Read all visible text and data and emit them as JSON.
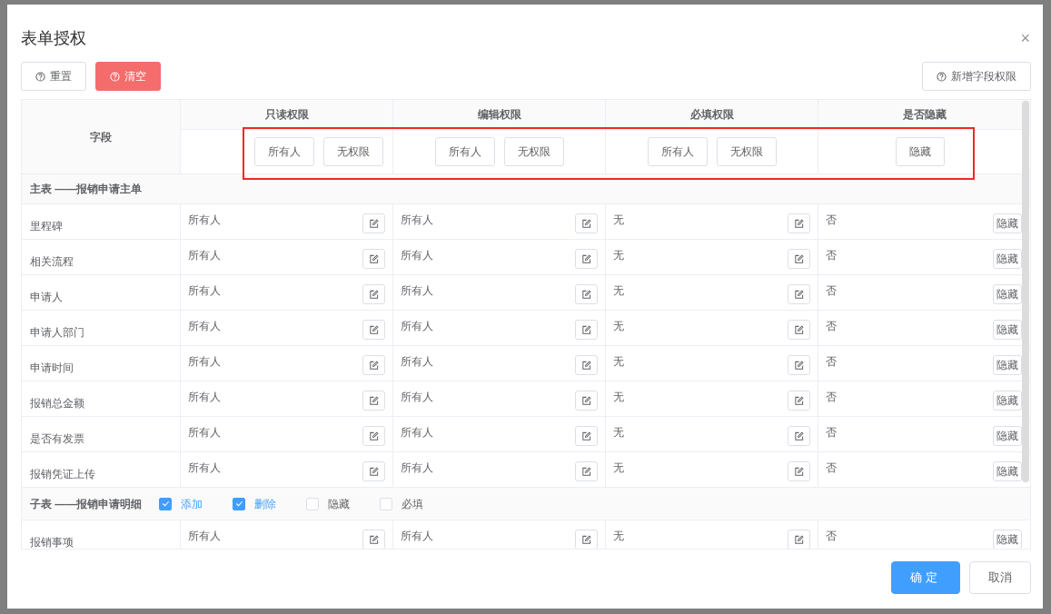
{
  "dialog": {
    "title": "表单授权",
    "close": "×"
  },
  "toolbar": {
    "left": [
      {
        "label": "重置",
        "kind": "default"
      },
      {
        "label": "清空",
        "kind": "danger"
      }
    ],
    "right": [
      {
        "label": "新增字段权限",
        "kind": "default"
      }
    ]
  },
  "table": {
    "columns": [
      "字段",
      "只读权限",
      "编辑权限",
      "必填权限",
      "是否隐藏"
    ],
    "header_actions": [
      [
        "所有人",
        "无权限"
      ],
      [
        "所有人",
        "无权限"
      ],
      [
        "所有人",
        "无权限"
      ],
      [
        "隐藏"
      ]
    ],
    "sections": [
      {
        "title": "主表 ——报销申请主单",
        "rows": [
          {
            "field": "里程碑",
            "readonly": "所有人",
            "edit": "所有人",
            "required": "无",
            "hidden": "否",
            "hide_button": "隐藏"
          },
          {
            "field": "相关流程",
            "readonly": "所有人",
            "edit": "所有人",
            "required": "无",
            "hidden": "否",
            "hide_button": "隐藏"
          },
          {
            "field": "申请人",
            "readonly": "所有人",
            "edit": "所有人",
            "required": "无",
            "hidden": "否",
            "hide_button": "隐藏"
          },
          {
            "field": "申请人部门",
            "readonly": "所有人",
            "edit": "所有人",
            "required": "无",
            "hidden": "否",
            "hide_button": "隐藏"
          },
          {
            "field": "申请时间",
            "readonly": "所有人",
            "edit": "所有人",
            "required": "无",
            "hidden": "否",
            "hide_button": "隐藏"
          },
          {
            "field": "报销总金额",
            "readonly": "所有人",
            "edit": "所有人",
            "required": "无",
            "hidden": "否",
            "hide_button": "隐藏"
          },
          {
            "field": "是否有发票",
            "readonly": "所有人",
            "edit": "所有人",
            "required": "无",
            "hidden": "否",
            "hide_button": "隐藏"
          },
          {
            "field": "报销凭证上传",
            "readonly": "所有人",
            "edit": "所有人",
            "required": "无",
            "hidden": "否",
            "hide_button": "隐藏"
          }
        ]
      },
      {
        "title": "子表 ——报销申请明细",
        "options": [
          {
            "label": "添加",
            "checked": true
          },
          {
            "label": "删除",
            "checked": true
          },
          {
            "label": "隐藏",
            "checked": false
          },
          {
            "label": "必填",
            "checked": false
          }
        ],
        "rows": [
          {
            "field": "报销事项",
            "readonly": "所有人",
            "edit": "所有人",
            "required": "无",
            "hidden": "否",
            "hide_button": "隐藏"
          }
        ]
      }
    ]
  },
  "footer": [
    {
      "label": "确定",
      "kind": "primary"
    },
    {
      "label": "取消",
      "kind": "default"
    }
  ]
}
